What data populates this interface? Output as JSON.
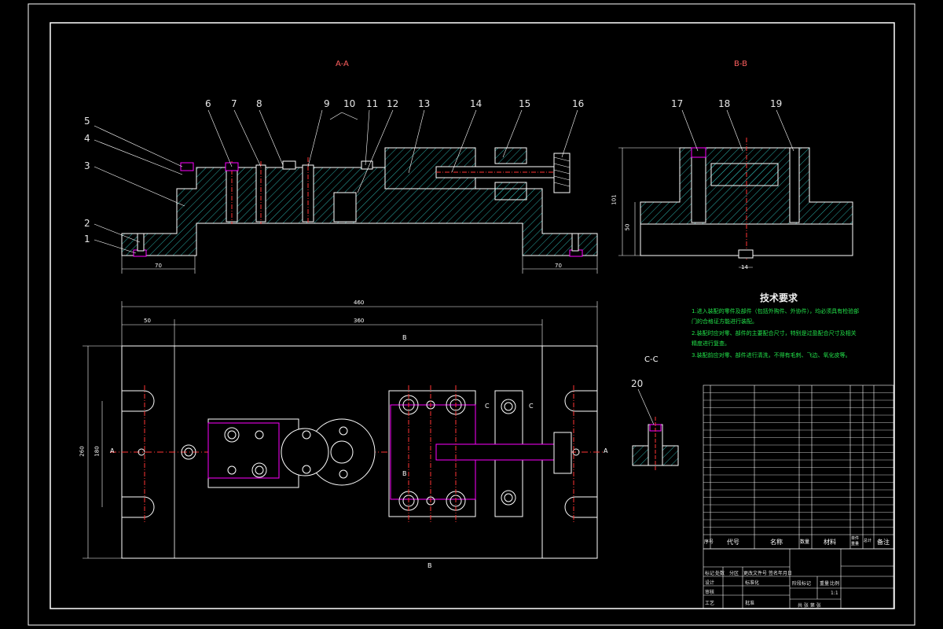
{
  "drawing": {
    "views": {
      "aa": "A-A",
      "bb": "B-B",
      "cc": "C-C"
    },
    "callouts": {
      "c1": "1",
      "c2": "2",
      "c3": "3",
      "c4": "4",
      "c5": "5",
      "c6": "6",
      "c7": "7",
      "c8": "8",
      "c9": "9",
      "c10": "10",
      "c11": "11",
      "c12": "12",
      "c13": "13",
      "c14": "14",
      "c15": "15",
      "c16": "16",
      "c17": "17",
      "c18": "18",
      "c19": "19",
      "c20": "20"
    },
    "dimensions": {
      "left_foot": "70",
      "right_foot": "70",
      "bb_height": "101",
      "bb_inner": "50",
      "bb_bottom": "14",
      "total_width": "460",
      "left_offset": "50",
      "inner_width": "360",
      "total_height": "260",
      "inner_height": "180"
    },
    "section_marks": {
      "b_top": "B",
      "b_bottom": "B",
      "a_left": "A",
      "a_right": "A",
      "c_left": "C",
      "c_right": "C",
      "b_mid": "B"
    },
    "tech_requirements": {
      "title": "技术要求",
      "line1": "1.进入装配的零件及部件（包括外购件、外协件），均必须具有检验部门的合格证方能进行装配。",
      "line2": "2.装配时应对零、部件的主要配合尺寸，特别是过盈配合尺寸及相关精度进行复查。",
      "line3": "3.装配前应对零、部件进行清洗，不得有毛刺、飞边、氧化皮等。"
    },
    "bom": {
      "headers": {
        "seq": "序号",
        "code": "代号",
        "name": "名称",
        "qty": "数量",
        "material": "材料",
        "unit_weight": "单件重量",
        "total_weight": "总计",
        "note": "备注"
      },
      "title_block": {
        "r1c1": "标记",
        "r1c2": "处数",
        "r1c3": "分区",
        "r1c4": "更改文件号",
        "r1c5": "签名",
        "r1c6": "年月日",
        "r2c1": "设计",
        "r2c2": "标准化",
        "r3c1": "审核",
        "r4c1": "工艺",
        "r4c2": "批准",
        "stage": "阶段标记",
        "weight": "重量",
        "scale": "比例",
        "scale_val": "1:1",
        "sheets": "共 张 第 张"
      }
    }
  }
}
